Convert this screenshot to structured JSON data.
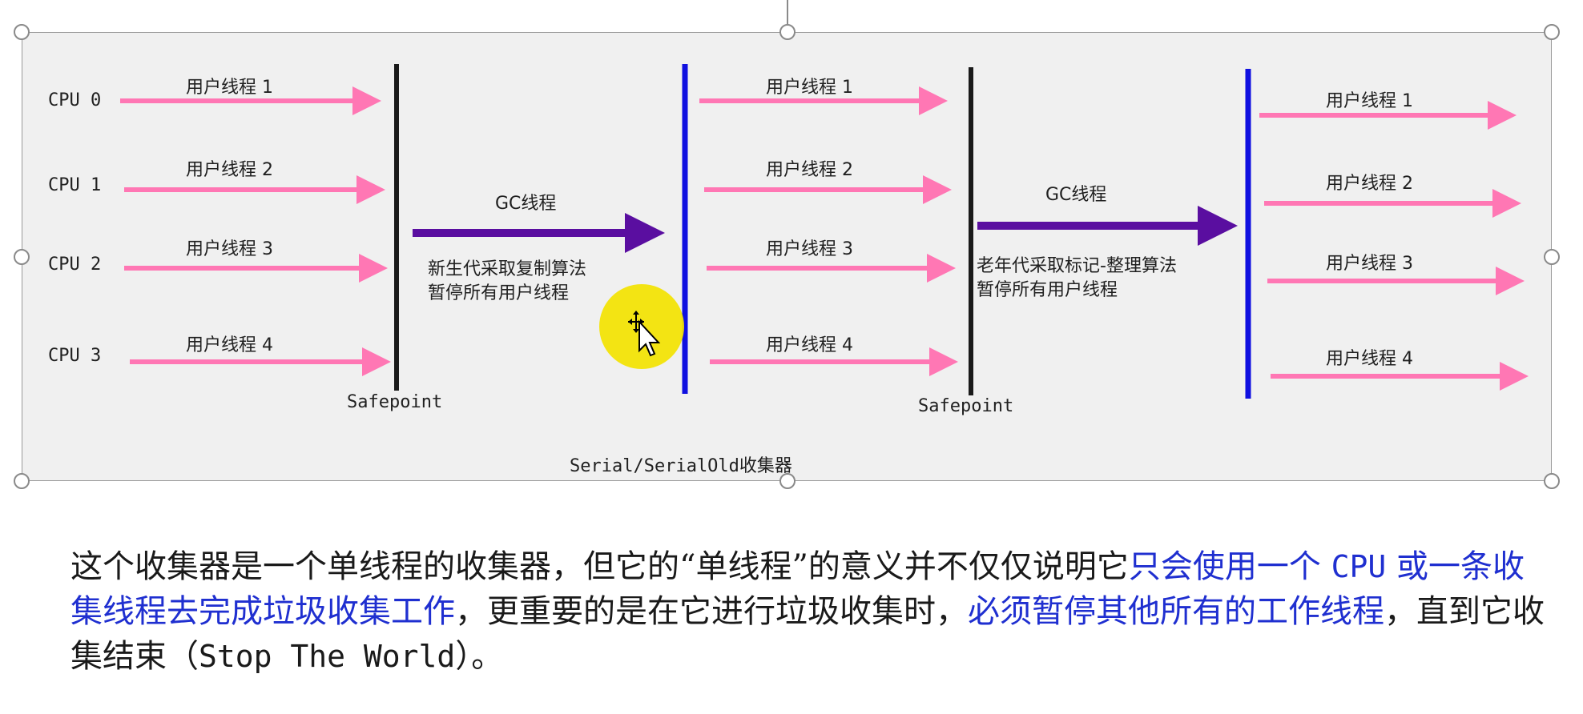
{
  "diagram": {
    "cpu_labels": [
      "CPU 0",
      "CPU 1",
      "CPU 2",
      "CPU 3"
    ],
    "thread_labels": [
      "用户线程 1",
      "用户线程 2",
      "用户线程 3",
      "用户线程 4"
    ],
    "gc_label": "GC线程",
    "young_note": "新生代采取复制算法\n暂停所有用户线程",
    "old_note": "老年代采取标记-整理算法\n暂停所有用户线程",
    "safepoint_label": "Safepoint",
    "caption": "Serial/SerialOld收集器",
    "colors": {
      "user_thread_arrow": "#ff77b4",
      "gc_arrow": "#5a0ea0",
      "safepoint_line": "#1a1a1a",
      "resume_line": "#1010e0"
    }
  },
  "paragraph": {
    "part1": "这个收集器是一个单线程的收集器，但它的“单线程”的意义并不仅仅说明它",
    "blue1a": "只会使用一个 ",
    "blue1_code": "CPU",
    "blue1b": " 或一条收集线程去完成垃圾收集工作",
    "part2": "，更重要的是在它进行垃圾收集时，",
    "blue2": "必须暂停其他所有的工作线程",
    "part3": "，直到它收集结束（",
    "code": "Stop The World",
    "part4": "）。"
  }
}
